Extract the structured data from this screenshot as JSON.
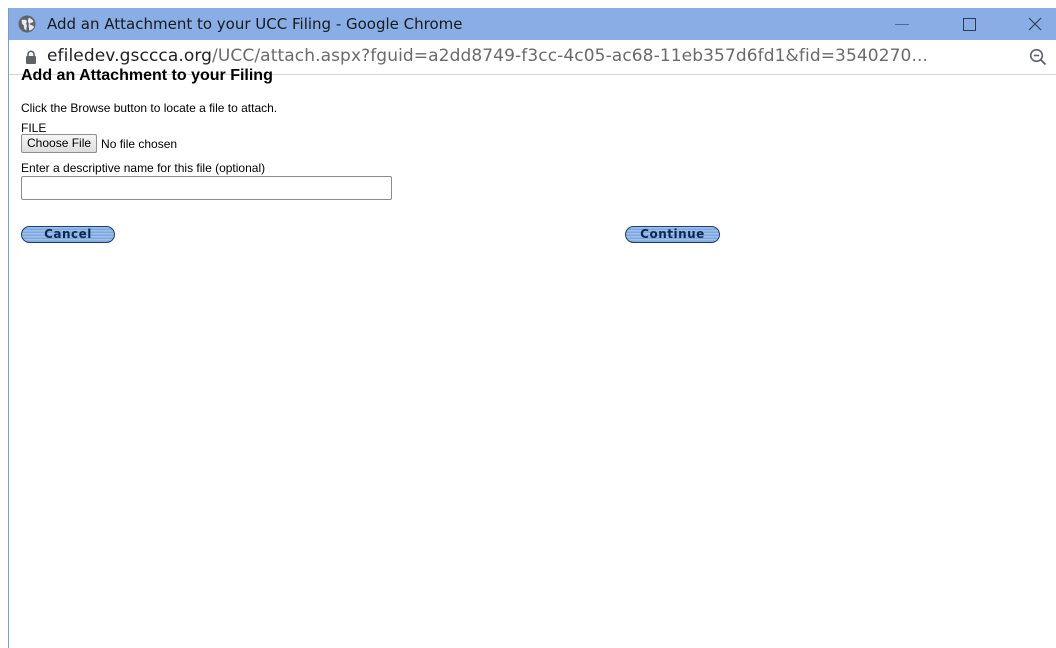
{
  "window": {
    "title": "Add an Attachment to your UCC Filing - Google Chrome"
  },
  "address": {
    "host": "efiledev.gsccca.org",
    "path": "/UCC/attach.aspx?fguid=a2dd8749-f3cc-4c05-ac68-11eb357d6fd1&fid=3540270..."
  },
  "page": {
    "heading": "Add an Attachment to your Filing",
    "instruction": "Click the Browse button to locate a file to attach.",
    "file_label": "FILE",
    "choose_file_label": "Choose File",
    "no_file_text": "No file chosen",
    "name_label": "Enter a descriptive name for this file (optional)",
    "name_value": "",
    "cancel_label": "Cancel",
    "continue_label": "Continue"
  },
  "colors": {
    "titlebar": "#88aee5",
    "button_fill": "#7ea7dc",
    "button_border": "#1c3d72"
  },
  "icons": {
    "title": "globe-icon",
    "address": "lock-icon",
    "zoom": "zoom-icon"
  }
}
